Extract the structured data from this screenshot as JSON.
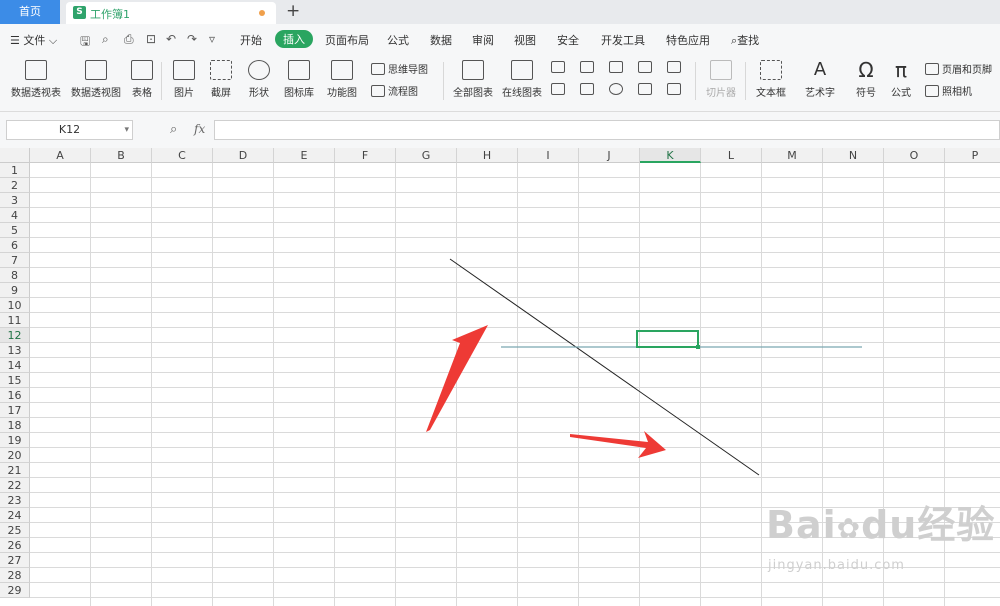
{
  "tabbar": {
    "home_label": "首页",
    "doc_icon": "S",
    "doc_name": "工作簿1",
    "new_tab": "+"
  },
  "menubar": {
    "file_label": "文件",
    "tabs": [
      "开始",
      "插入",
      "页面布局",
      "公式",
      "数据",
      "审阅",
      "视图",
      "安全",
      "开发工具",
      "特色应用"
    ],
    "active_tab": "插入",
    "search_label": "查找"
  },
  "ribbon": {
    "buttons": [
      "数据透视表",
      "数据透视图",
      "表格",
      "图片",
      "截屏",
      "形状",
      "图标库",
      "功能图",
      "全部图表",
      "在线图表",
      "切片器",
      "文本框",
      "艺术字",
      "符号",
      "公式"
    ],
    "small_buttons": [
      "思维导图",
      "流程图",
      "页眉和页脚",
      "照相机"
    ]
  },
  "formula_bar": {
    "name_box": "K12",
    "fx_label": "fx",
    "formula": ""
  },
  "sheet": {
    "columns": [
      "A",
      "B",
      "C",
      "D",
      "E",
      "F",
      "G",
      "H",
      "I",
      "J",
      "K",
      "L",
      "M",
      "N",
      "O",
      "P"
    ],
    "rows": [
      "1",
      "2",
      "3",
      "4",
      "5",
      "6",
      "7",
      "8",
      "9",
      "10",
      "11",
      "12",
      "13",
      "14",
      "15",
      "16",
      "17",
      "18",
      "19",
      "20",
      "21",
      "22",
      "23",
      "24",
      "25",
      "26",
      "27",
      "28",
      "29"
    ],
    "selected_column": "K",
    "selected_row": "12",
    "selection_color": "#2aa560",
    "line_colors": {
      "diagonal": "#222222",
      "horizontal": "#7aa6b0",
      "arrow": "#ee3a35"
    }
  },
  "watermark": {
    "brand": "Bai",
    "brand_mid": "du",
    "brand_cn": "经验",
    "url": "jingyan.baidu.com"
  }
}
